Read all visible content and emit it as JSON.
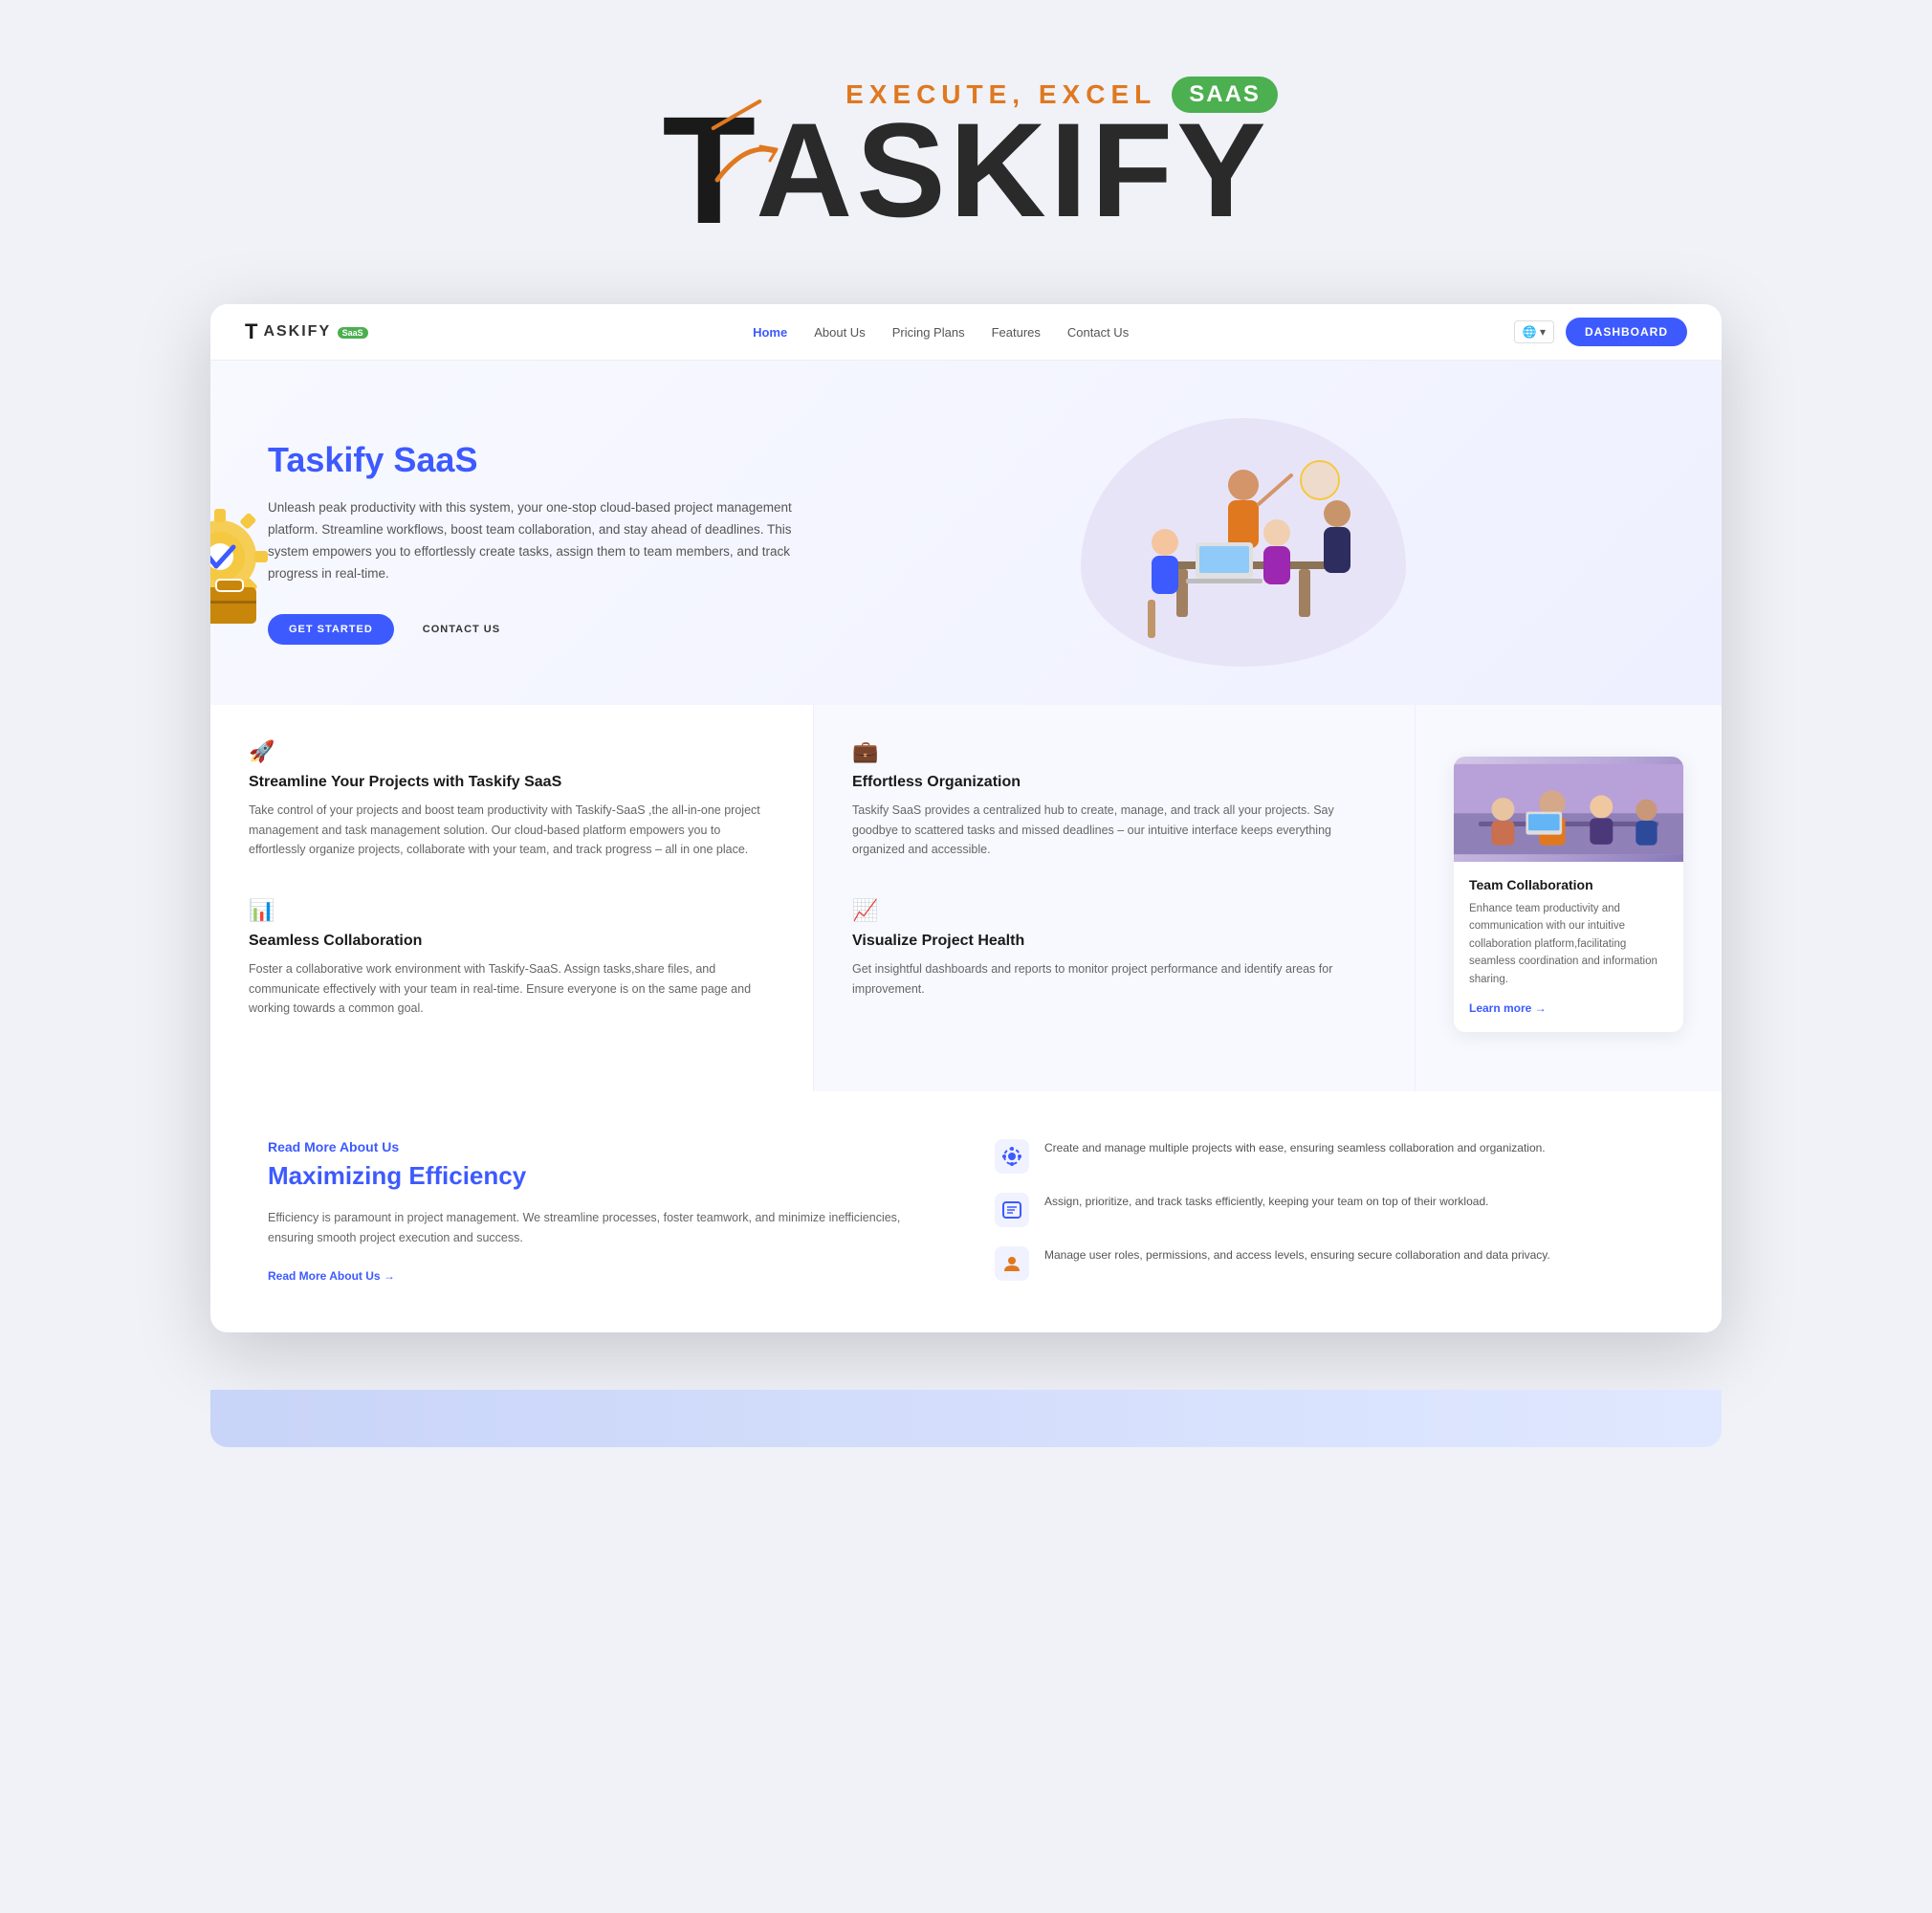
{
  "hero_logo": {
    "tagline": "EXECUTE, EXCEL",
    "saas_badge": "SaaS",
    "letter_t": "T",
    "brand_name": "ASKIFY"
  },
  "navbar": {
    "logo_t": "T",
    "logo_text": "ASKIFY",
    "logo_saas": "SaaS",
    "links": [
      {
        "label": "Home",
        "active": true
      },
      {
        "label": "About Us",
        "active": false
      },
      {
        "label": "Pricing Plans",
        "active": false
      },
      {
        "label": "Features",
        "active": false
      },
      {
        "label": "Contact Us",
        "active": false
      }
    ],
    "lang": "🌐 ▾",
    "dashboard_btn": "DASHBOARD"
  },
  "hero": {
    "title": "Taskify SaaS",
    "description": "Unleash peak productivity with this system, your one-stop cloud-based project management platform. Streamline workflows, boost team collaboration, and stay ahead of deadlines. This system empowers you to effortlessly create tasks, assign them to team members, and track progress in real-time.",
    "btn_get_started": "GET STARTED",
    "btn_contact_us": "CONTACT US"
  },
  "features": {
    "col1": [
      {
        "icon": "🚀",
        "title": "Streamline Your Projects with Taskify SaaS",
        "desc": "Take control of your projects and boost team productivity with Taskify-SaaS ,the all-in-one project management and task management solution. Our cloud-based platform empowers you to effortlessly organize projects, collaborate with your team, and track progress – all in one place."
      },
      {
        "icon": "📊",
        "title": "Seamless Collaboration",
        "desc": "Foster a collaborative work environment with Taskify-SaaS. Assign tasks,share files, and communicate effectively with your team in real-time. Ensure everyone is on the same page and working towards a common goal."
      }
    ],
    "col2": [
      {
        "icon": "💼",
        "title": "Effortless Organization",
        "desc": "Taskify SaaS provides a centralized hub to create, manage, and track all your projects. Say goodbye to scattered tasks and missed deadlines – our intuitive interface keeps everything organized and accessible."
      },
      {
        "icon": "📈",
        "title": "Visualize Project Health",
        "desc": "Get insightful dashboards and reports to monitor project performance and identify areas for improvement."
      }
    ],
    "card": {
      "title": "Team Collaboration",
      "desc": "Enhance team productivity and communication with our intuitive collaboration platform,facilitating seamless coordination and information sharing.",
      "learn_more": "Learn more"
    }
  },
  "about": {
    "subtitle": "Read More About Us",
    "title": "Maximizing Efficiency",
    "desc": "Efficiency is paramount in project management. We streamline processes, foster teamwork, and minimize inefficiencies, ensuring smooth project execution and success.",
    "link": "Read More About Us",
    "features": [
      {
        "icon": "⚙️",
        "text": "Create and manage multiple projects with ease, ensuring seamless collaboration and organization."
      },
      {
        "icon": "📋",
        "text": "Assign, prioritize, and track tasks efficiently, keeping your team on top of their workload."
      },
      {
        "icon": "👤",
        "text": "Manage user roles, permissions, and access levels, ensuring secure collaboration and data privacy."
      }
    ]
  }
}
